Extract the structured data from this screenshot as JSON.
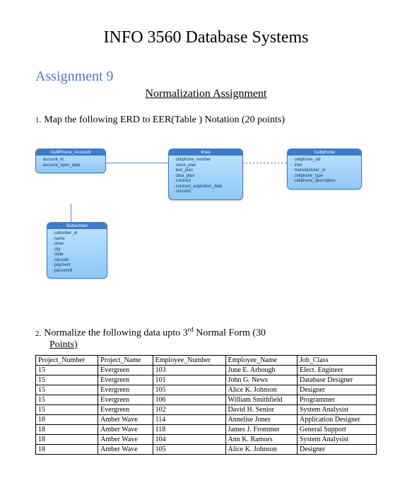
{
  "title": "INFO 3560 Database Systems",
  "assignment": "Assignment 9",
  "subtitle": "Normalization Assignment",
  "q1": {
    "num": "1.",
    "text": "Map the following ERD to EER(Table ) Notation (20 points)"
  },
  "erd": {
    "account": {
      "name": "CellPhone_Account",
      "attrs": [
        "account_id",
        "account_open_date"
      ]
    },
    "lines": {
      "name": "lines",
      "attrs": [
        "cellphone_number",
        "voice_plan",
        "text_plan",
        "data_plan",
        "contract",
        "contract_expiration_date",
        "simcard"
      ]
    },
    "cellphone": {
      "name": "Cellphone",
      "attrs": [
        "cellphone_sid",
        "imei",
        "manufacturer_id",
        "cellphone_type",
        "cellphone_description"
      ]
    },
    "subscriber": {
      "name": "Subscriber",
      "attrs": [
        "subsriber_id",
        "name",
        "stree",
        "city",
        "state",
        "zipcode",
        "payment",
        "password"
      ]
    }
  },
  "q2": {
    "num": "2.",
    "text_a": "Normalize the following data upto 3",
    "sup": "rd",
    "text_b": " Normal Form (30",
    "points_label": "Points)"
  },
  "table": {
    "headers": [
      "Project_Number",
      "Project_Name",
      "Employee_Number",
      "Employee_Name",
      "Job_Class"
    ],
    "rows": [
      [
        "15",
        "Evergreen",
        "103",
        "June E. Arbough",
        "Elect. Engineer"
      ],
      [
        "15",
        "Evergreen",
        "101",
        "John G. News",
        "Database Designer"
      ],
      [
        "15",
        "Evergreen",
        "105",
        "Alice K. Johnson",
        "Designer"
      ],
      [
        "15",
        "Evergreen",
        "106",
        "William Smithfield",
        "Programmer"
      ],
      [
        "15",
        "Evergreen",
        "102",
        "David H. Senior",
        "System Analysist"
      ],
      [
        "18",
        "Amber Wave",
        "114",
        "Annelise Jones",
        "Application Designer"
      ],
      [
        "18",
        "Amber Wave",
        "118",
        "James J. Frommer",
        "General Support"
      ],
      [
        "18",
        "Amber Wave",
        "104",
        "Ann K. Ramors",
        "System Analysist"
      ],
      [
        "18",
        "Amber Wave",
        "105",
        "Alice K. Johnson",
        "Designer"
      ]
    ]
  }
}
